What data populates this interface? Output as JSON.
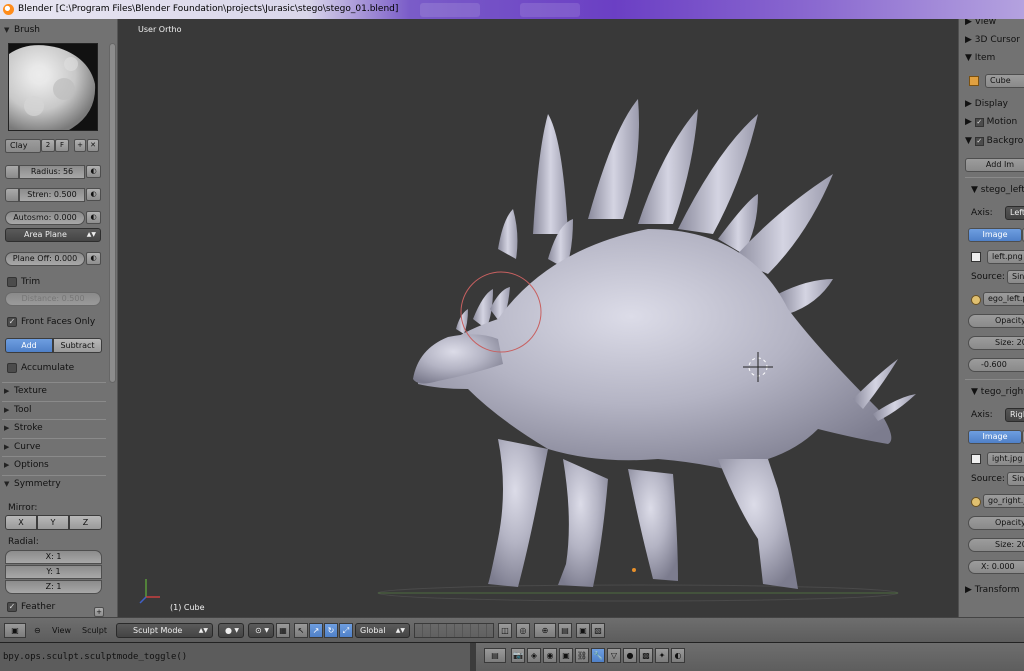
{
  "window": {
    "title": "Blender [C:\\Program Files\\Blender Foundation\\projects\\Jurasic\\stego\\stego_01.blend]"
  },
  "brush": {
    "header": "Brush",
    "name": "Clay",
    "users": "2",
    "fake": "F",
    "radius": "Radius: 56",
    "strength": "Stren: 0.500",
    "autosmooth": "Autosmo: 0.000",
    "plane": "Area Plane",
    "plane_offset": "Plane Off: 0.000",
    "trim": "Trim",
    "distance": "Distance: 0.500",
    "front_faces_only": "Front Faces Only",
    "add": "Add",
    "subtract": "Subtract",
    "accumulate": "Accumulate"
  },
  "sections": {
    "texture": "Texture",
    "tool": "Tool",
    "stroke": "Stroke",
    "curve": "Curve",
    "options": "Options",
    "symmetry": "Symmetry"
  },
  "symmetry": {
    "mirror_label": "Mirror:",
    "x": "X",
    "y": "Y",
    "z": "Z",
    "radial_label": "Radial:",
    "rx": "X: 1",
    "ry": "Y: 1",
    "rz": "Z: 1",
    "feather": "Feather"
  },
  "viewport": {
    "view_label": "User Ortho",
    "object_label": "(1) Cube"
  },
  "properties": {
    "view": "View",
    "cursor": "3D Cursor",
    "item": "Item",
    "item_name": "Cube",
    "display": "Display",
    "motion": "Motion",
    "background": "Backgro",
    "add_image": "Add Im",
    "left": {
      "name": "stego_left",
      "axis_label": "Axis:",
      "axis_value": "Left",
      "image_tab": "Image",
      "file": "left.png",
      "source_label": "Source:",
      "source_value": "Sing",
      "filepath": "ego_left.p",
      "opacity": "Opacity:",
      "size": "Size: 20",
      "offset": "-0.600"
    },
    "right": {
      "name": "tego_right",
      "axis_label": "Axis:",
      "axis_value": "Righ",
      "image_tab": "Image",
      "file": "ight.jpg",
      "source_label": "Source:",
      "source_value": "Sing",
      "filepath": "go_right.jp",
      "opacity": "Opacity:",
      "size": "Size: 20",
      "offset": "X: 0.000"
    },
    "transform": "Transform"
  },
  "header": {
    "view": "View",
    "sculpt": "Sculpt",
    "mode": "Sculpt Mode",
    "orientation": "Global"
  },
  "console": {
    "text": "bpy.ops.sculpt.sculptmode_toggle()"
  },
  "colors": {
    "accent": "#5a8bd6",
    "panel": "#727272",
    "viewport": "#393939",
    "model": "#b8b8c8"
  }
}
